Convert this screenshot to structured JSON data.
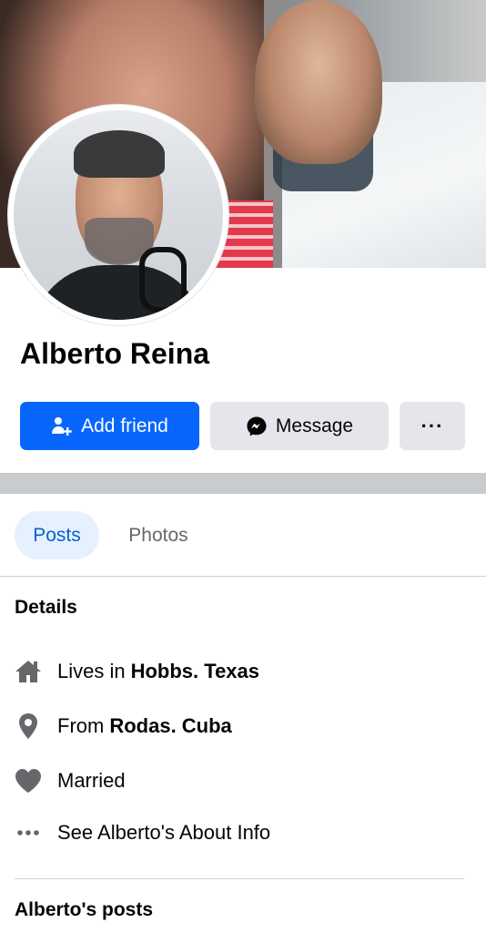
{
  "profile": {
    "name": "Alberto Reina"
  },
  "actions": {
    "add_friend": "Add friend",
    "message": "Message",
    "more": "···"
  },
  "tabs": [
    {
      "label": "Posts",
      "active": true
    },
    {
      "label": "Photos",
      "active": false
    }
  ],
  "details": {
    "title": "Details",
    "items": [
      {
        "icon": "home-icon",
        "prefix": "Lives in",
        "value": "Hobbs. Texas"
      },
      {
        "icon": "location-pin-icon",
        "prefix": "From",
        "value": "Rodas. Cuba"
      },
      {
        "icon": "heart-icon",
        "prefix": "Married",
        "value": ""
      },
      {
        "icon": "more-dots-icon",
        "prefix": "See Alberto's About Info",
        "value": ""
      }
    ]
  },
  "posts_section": {
    "title": "Alberto's posts"
  },
  "colors": {
    "primary": "#0866ff",
    "secondary_button": "#e4e6eb",
    "active_tab_bg": "#e7f0fd",
    "active_tab_text": "#0064d1",
    "icon_gray": "#65676b"
  }
}
